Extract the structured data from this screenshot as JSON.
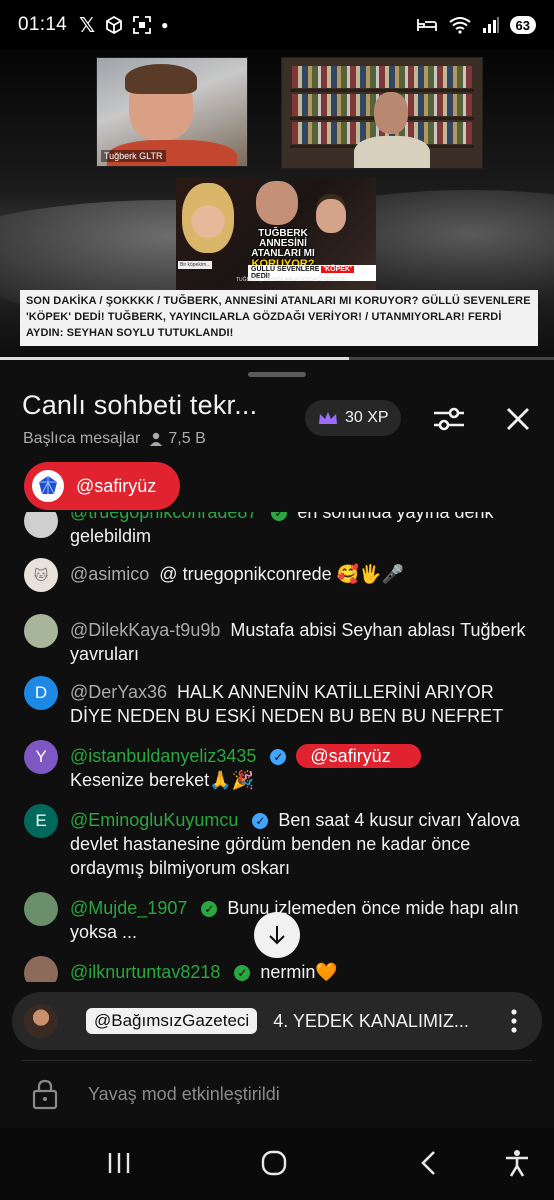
{
  "status_bar": {
    "time": "01:14",
    "left_icons": [
      "x-icon",
      "box-icon",
      "screenshot-icon",
      "dot-icon"
    ],
    "right_icons": [
      "sleep-icon",
      "wifi-icon",
      "signal-icon"
    ],
    "battery": "63"
  },
  "video": {
    "cam_label": "Tuğberk GLTR",
    "thumbnail": {
      "title_line1": "TUĞBERK",
      "title_line2": "ANNESİNİ ATANLARI MI",
      "title_line3": "KORUYOR?",
      "subtitle_pre": "GÜLLÜ SEVENLERE ",
      "subtitle_highlight": "'KÖPEK'",
      "subtitle_post": " DEDİ!",
      "small_text": "TUĞBERK, YAYINCILARLA GÖZDAĞI VERİYOR!",
      "note_text": "Bir köpekim..."
    },
    "banner_text": "SON DAKİKA / ŞOKKKK / TUĞBERK, ANNESİNİ ATANLARI MI KORUYOR? GÜLLÜ SEVENLERE 'KÖPEK' DEDİ! TUĞBERK, YAYINCILARLA GÖZDAĞI VERİYOR! / UTANMIYORLAR! FERDİ AYDIN: SEYHAN SOYLU TUTUKLANDI!",
    "progress": 0.63
  },
  "chat": {
    "title": "Canlı sohbeti tekr...",
    "mode_label": "Başlıca mesajlar",
    "viewer_count": "7,5 B",
    "xp_label": "30 XP",
    "pinned_user": "@safiryüz",
    "messages": [
      {
        "author": "@truegopnikconrade87",
        "member": true,
        "badge": "green",
        "avatar_color": "#cfcfcf",
        "text": "en sonunda yayına denk gelebildim"
      },
      {
        "author": "@asimico",
        "member": false,
        "avatar_color": "#e8e3da",
        "text": "@ truegopnikconrede 🥰🖐🎤"
      },
      {
        "author": "@DilekKaya-t9u9b",
        "member": false,
        "avatar_color": "#a7b59a",
        "text": "Mustafa abisi Seyhan ablası Tuğberk yavruları"
      },
      {
        "author": "@DerYax36",
        "member": false,
        "avatar_letter": "D",
        "avatar_color": "#1e88e5",
        "text": "HALK ANNENİN KATİLLERİNİ ARIYOR DİYE NEDEN BU ESKİ NEDEN BU BEN BU NEFRET"
      },
      {
        "author": "@istanbuldanyeliz3435",
        "member": true,
        "badge": "blue",
        "avatar_letter": "Y",
        "avatar_color": "#7e57c2",
        "mention": "@safiryüz",
        "text": "Kesenize bereket🙏🎉"
      },
      {
        "author": "@EminogluKuyumcu",
        "member": true,
        "badge": "blue",
        "avatar_letter": "E",
        "avatar_color": "#00695c",
        "text": "Ben saat 4 kusur civarı Yalova devlet hastanesine gördüm benden ne kadar önce ordaymış bilmiyorum oskarı"
      },
      {
        "author": "@Mujde_1907",
        "member": true,
        "badge": "green",
        "avatar_color": "#6a8f6a",
        "text": "Bunu izlemeden önce mide hapı alın yoksa ..."
      },
      {
        "author": "@ilknurtuntav8218",
        "member": true,
        "badge": "green",
        "avatar_color": "#8c6b5b",
        "text": "nermin🧡"
      }
    ],
    "ticker": {
      "user": "@BağımsızGazeteci",
      "text": "4. YEDEK KANALIMIZ..."
    },
    "slow_mode_text": "Yavaş mod etkinleştirildi"
  },
  "colors": {
    "accent_red": "#e0232e",
    "member_green": "#2ba640",
    "verified_blue": "#3ea6ff",
    "background": "#0f0f0f"
  },
  "nav_icons": [
    "recent-apps-icon",
    "home-icon",
    "back-icon",
    "accessibility-icon"
  ]
}
